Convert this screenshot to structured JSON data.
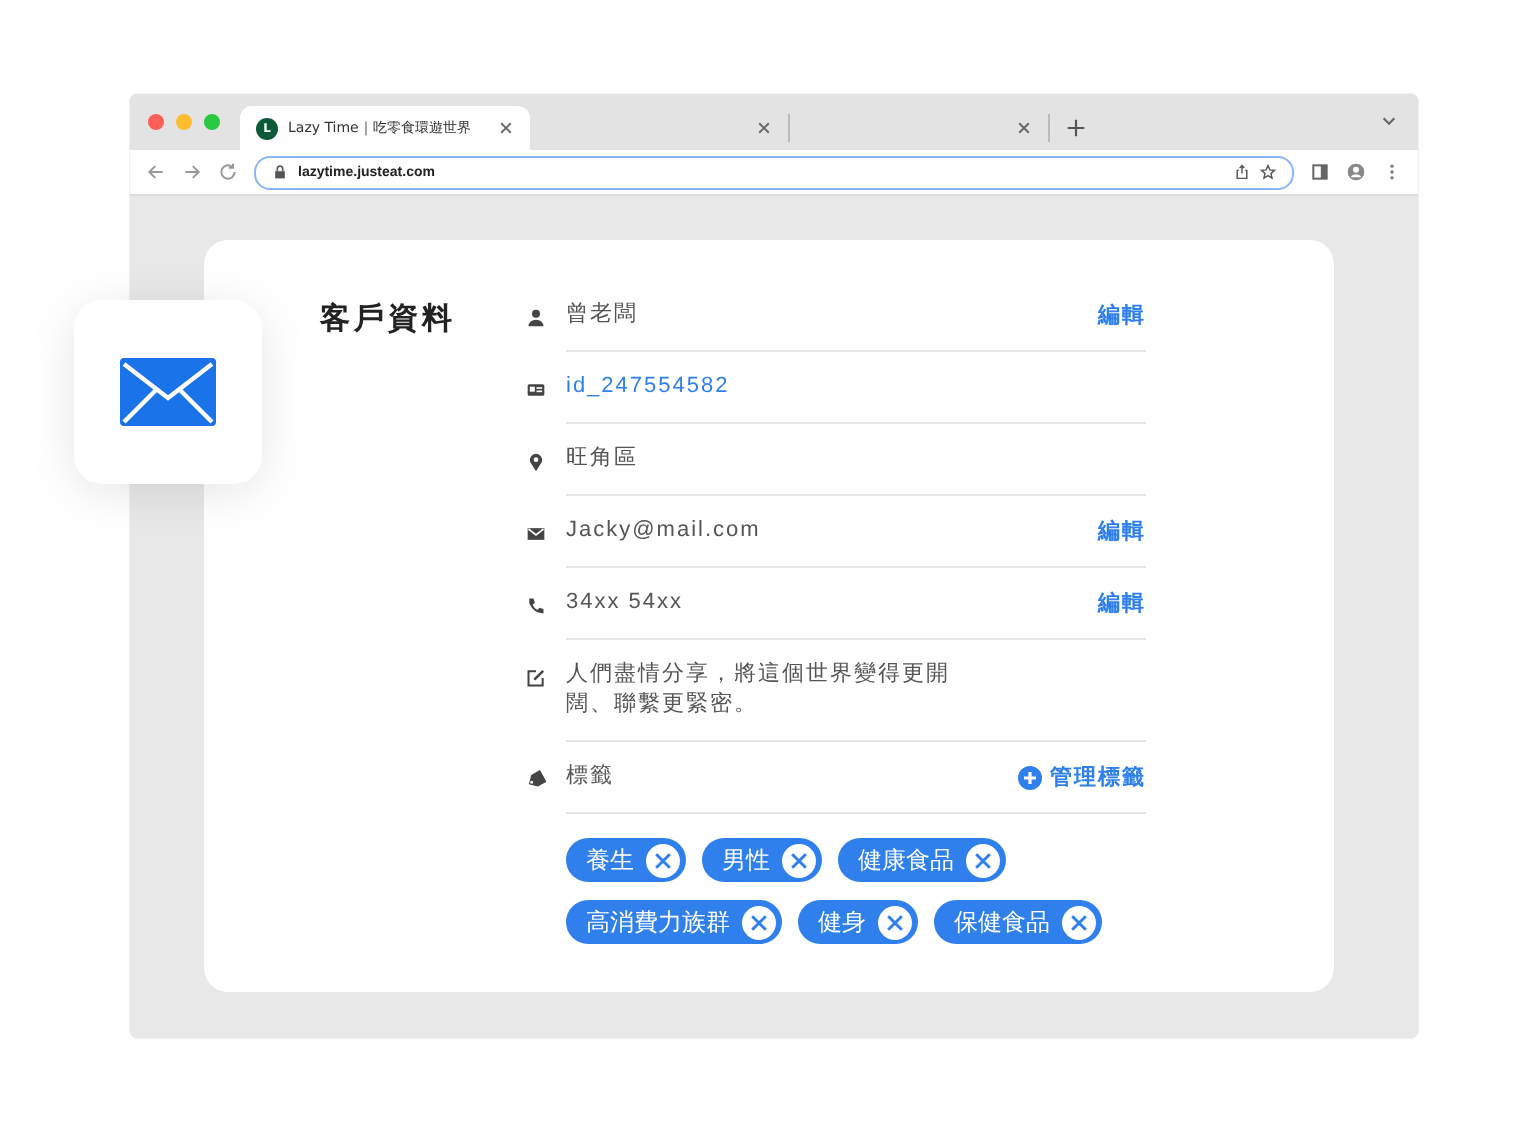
{
  "browser": {
    "tabs": [
      {
        "title": "Lazy Time｜吃零食環遊世界",
        "logo": "L",
        "selected": true
      },
      {
        "selected": false
      },
      {
        "selected": false
      }
    ],
    "url": "lazytime.justeat.com"
  },
  "card": {
    "title": "客戶資料",
    "rows": [
      {
        "kind": "name",
        "text": "曾老闆",
        "action": "編輯"
      },
      {
        "kind": "id",
        "text": "id_247554582"
      },
      {
        "kind": "location",
        "text": "旺角區"
      },
      {
        "kind": "email",
        "text": "Jacky@mail.com",
        "action": "編輯"
      },
      {
        "kind": "phone",
        "text": "34xx 54xx",
        "action": "編輯"
      },
      {
        "kind": "bio",
        "text": "人們盡情分享，將這個世界變得更開闊、聯繫更緊密。"
      },
      {
        "kind": "tags",
        "text": "標籤",
        "action": "管理標籤"
      }
    ],
    "tags": [
      "養生",
      "男性",
      "健康食品",
      "高消費力族群",
      "健身",
      "保健食品"
    ]
  }
}
